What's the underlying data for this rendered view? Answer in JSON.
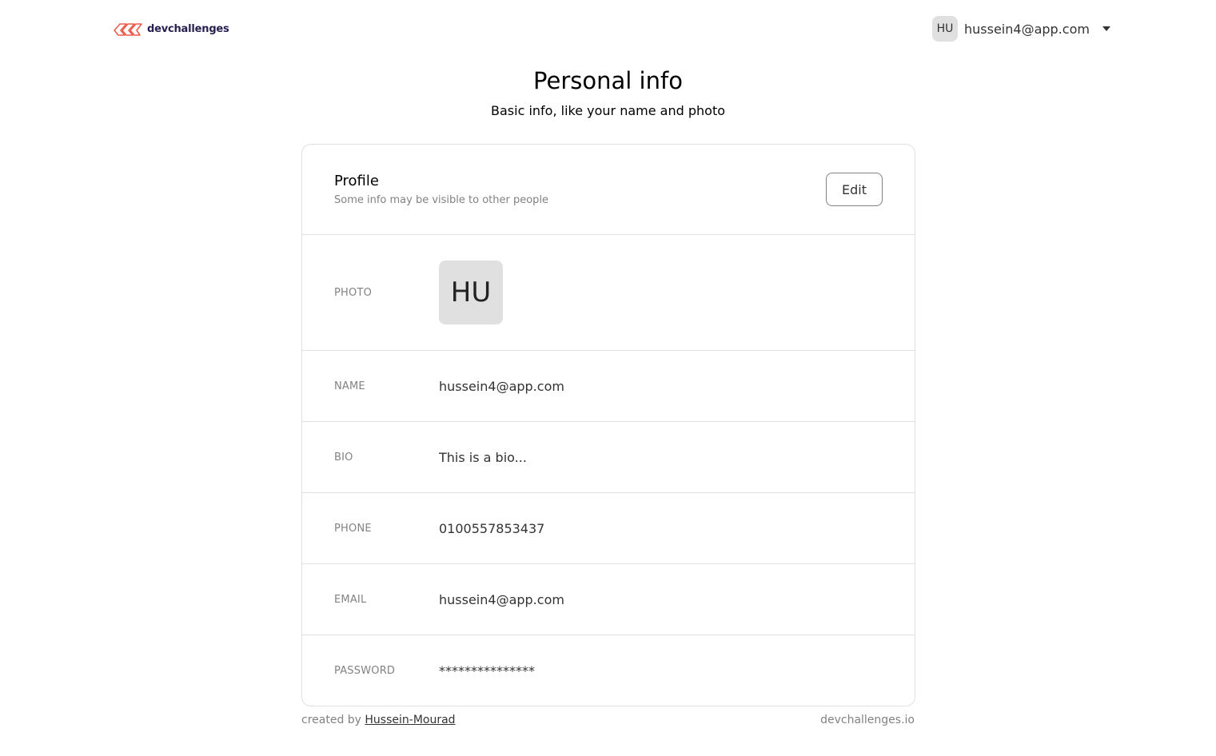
{
  "header": {
    "logo_text": "devchallenges",
    "user": {
      "initials": "HU",
      "email": "hussein4@app.com"
    }
  },
  "page": {
    "title": "Personal info",
    "subtitle": "Basic info, like your name and photo"
  },
  "profile": {
    "title": "Profile",
    "description": "Some info may be visible to other people",
    "edit_label": "Edit",
    "rows": {
      "photo": {
        "label": "PHOTO",
        "initials": "HU"
      },
      "name": {
        "label": "NAME",
        "value": "hussein4@app.com"
      },
      "bio": {
        "label": "BIO",
        "value": "This is a bio..."
      },
      "phone": {
        "label": "PHONE",
        "value": "0100557853437"
      },
      "email": {
        "label": "EMAIL",
        "value": "hussein4@app.com"
      },
      "password": {
        "label": "PASSWORD",
        "value": "***************"
      }
    }
  },
  "footer": {
    "created_by_prefix": "created by ",
    "author": "Hussein-Mourad",
    "site": "devchallenges.io"
  },
  "colors": {
    "logo_accent": "#ED5B4B",
    "logo_text": "#282051",
    "border": "#e0e0e0",
    "muted": "#828282"
  }
}
